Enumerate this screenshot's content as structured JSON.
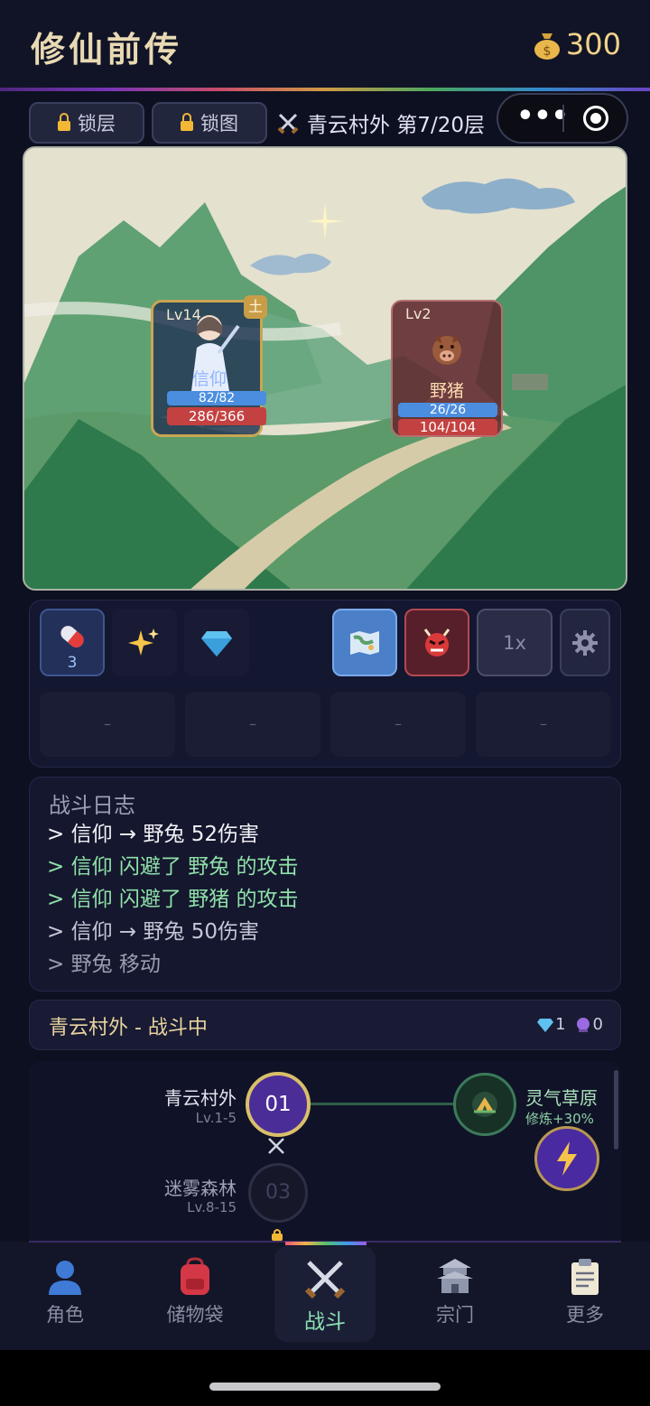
{
  "header": {
    "title": "修仙前传",
    "coins": "300"
  },
  "toolbar": {
    "lock_floor": "锁层",
    "lock_map": "锁图",
    "stage": "青云村外 第7/20层",
    "more": "•••"
  },
  "battle": {
    "hero": {
      "level": "Lv14",
      "element": "土",
      "name": "信仰",
      "mp": "82/82",
      "hp": "286/366"
    },
    "enemy": {
      "level": "Lv2",
      "name": "野猪",
      "mp": "26/26",
      "hp": "104/104"
    }
  },
  "skills": {
    "pill_count": "3",
    "speed": "1x",
    "slots": [
      "–",
      "–",
      "–",
      "–"
    ]
  },
  "log": {
    "title": "战斗日志",
    "lines": [
      {
        "text": "> 信仰 → 野兔 52伤害",
        "color": "#f2f2f5"
      },
      {
        "text": "> 信仰 闪避了 野兔 的攻击",
        "color": "#8fe0a8"
      },
      {
        "text": "> 信仰 闪避了 野猪 的攻击",
        "color": "#8fe0a8"
      },
      {
        "text": "> 信仰 → 野兔 50伤害",
        "color": "#c5c7d6"
      },
      {
        "text": "> 野兔 移动",
        "color": "#9a9cb0"
      }
    ]
  },
  "status": {
    "text": "青云村外 - 战斗中",
    "gems": "1",
    "orbs": "0"
  },
  "map": {
    "node1": {
      "number": "01",
      "name": "青云村外",
      "level": "Lv.1-5"
    },
    "node3": {
      "number": "03",
      "name": "迷雾森林",
      "level": "Lv.8-15"
    },
    "grass": {
      "name": "灵气草原",
      "bonus": "修炼+30%"
    }
  },
  "nav": [
    {
      "label": "角色"
    },
    {
      "label": "储物袋"
    },
    {
      "label": "战斗"
    },
    {
      "label": "宗门"
    },
    {
      "label": "更多"
    }
  ]
}
